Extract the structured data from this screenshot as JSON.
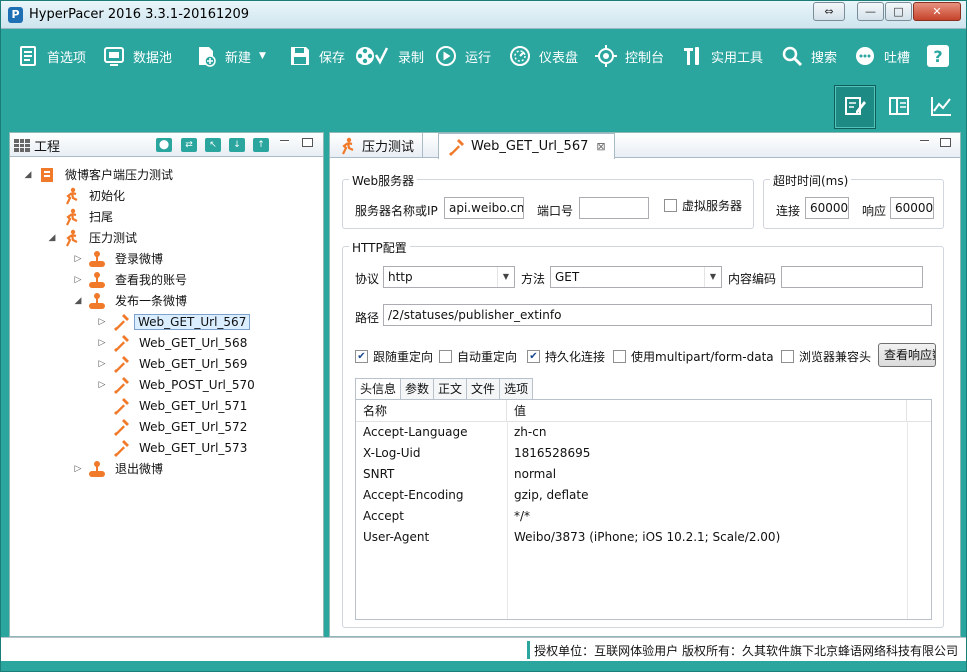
{
  "window": {
    "title": "HyperPacer  2016 3.3.1-20161209",
    "app_icon_letter": "P",
    "restore_symbol": "⇔",
    "minimize_symbol": "—",
    "maximize_symbol": "□",
    "close_symbol": "✕"
  },
  "colors": {
    "accent": "#2aa69f",
    "icon_orange": "#f07a2a",
    "selection": "#dbeeff"
  },
  "toolbar": {
    "items": [
      {
        "label": "首选项",
        "icon": "preferences-icon"
      },
      {
        "label": "数据池",
        "icon": "datapool-icon"
      },
      {
        "label": "新建",
        "icon": "new-file-icon"
      },
      {
        "label": "保存",
        "icon": "save-icon"
      },
      {
        "label": "录制",
        "icon": "record-icon"
      },
      {
        "label": "运行",
        "icon": "run-icon"
      },
      {
        "label": "仪表盘",
        "icon": "dashboard-icon"
      },
      {
        "label": "控制台",
        "icon": "console-icon"
      },
      {
        "label": "实用工具",
        "icon": "tools-icon"
      },
      {
        "label": "搜索",
        "icon": "search-icon"
      },
      {
        "label": "吐槽",
        "icon": "feedback-icon"
      },
      {
        "label": "",
        "icon": "help-icon"
      }
    ],
    "dropdown_symbol": "▼",
    "help_symbol": "?"
  },
  "viewbar": [
    "edit-view-icon",
    "panel-view-icon",
    "chart-view-icon"
  ],
  "project": {
    "tab_label": "工程",
    "tools": [
      "⬤",
      "⇄",
      "↖",
      "↓",
      "↑"
    ],
    "tree": [
      {
        "label": "微博客户端压力测试",
        "icon": "project-icon",
        "twisty": "◢",
        "depth": 0
      },
      {
        "label": "初始化",
        "icon": "runner-icon",
        "twisty": "",
        "depth": 1
      },
      {
        "label": "扫尾",
        "icon": "runner-icon",
        "twisty": "",
        "depth": 1
      },
      {
        "label": "压力测试",
        "icon": "runner-icon",
        "twisty": "◢",
        "depth": 1
      },
      {
        "label": "登录微博",
        "icon": "transaction-icon",
        "twisty": "▷",
        "depth": 2
      },
      {
        "label": "查看我的账号",
        "icon": "transaction-icon",
        "twisty": "▷",
        "depth": 2
      },
      {
        "label": "发布一条微博",
        "icon": "transaction-icon",
        "twisty": "◢",
        "depth": 2
      },
      {
        "label": "Web_GET_Url_567",
        "icon": "request-icon",
        "twisty": "▷",
        "depth": 3,
        "selected": true
      },
      {
        "label": "Web_GET_Url_568",
        "icon": "request-icon",
        "twisty": "▷",
        "depth": 3
      },
      {
        "label": "Web_GET_Url_569",
        "icon": "request-icon",
        "twisty": "▷",
        "depth": 3
      },
      {
        "label": "Web_POST_Url_570",
        "icon": "request-icon",
        "twisty": "▷",
        "depth": 3
      },
      {
        "label": "Web_GET_Url_571",
        "icon": "request-icon",
        "twisty": "",
        "depth": 3
      },
      {
        "label": "Web_GET_Url_572",
        "icon": "request-icon",
        "twisty": "",
        "depth": 3
      },
      {
        "label": "Web_GET_Url_573",
        "icon": "request-icon",
        "twisty": "",
        "depth": 3
      },
      {
        "label": "退出微博",
        "icon": "transaction-icon",
        "twisty": "▷",
        "depth": 2
      }
    ]
  },
  "editor": {
    "tabs": [
      {
        "label": "压力测试",
        "icon": "runner-icon",
        "active": false
      },
      {
        "label": "Web_GET_Url_567",
        "icon": "request-icon",
        "active": true,
        "close": "⊠"
      }
    ],
    "web_server": {
      "title": "Web服务器",
      "host_label": "服务器名称或IP",
      "host_value": "api.weibo.cn",
      "port_label": "端口号",
      "port_value": "",
      "virtual_label": "虚拟服务器",
      "virtual_checked": false
    },
    "timeout": {
      "title": "超时时间(ms)",
      "connect_label": "连接",
      "connect_value": "60000",
      "response_label": "响应",
      "response_value": "60000"
    },
    "http": {
      "title": "HTTP配置",
      "protocol_label": "协议",
      "protocol_value": "http",
      "method_label": "方法",
      "method_value": "GET",
      "encoding_label": "内容编码",
      "encoding_value": "",
      "path_label": "路径",
      "path_value": "/2/statuses/publisher_extinfo",
      "options": [
        {
          "label": "跟随重定向",
          "checked": true
        },
        {
          "label": "自动重定向",
          "checked": false
        },
        {
          "label": "持久化连接",
          "checked": true
        },
        {
          "label": "使用multipart/form-data",
          "checked": false
        },
        {
          "label": "浏览器兼容头",
          "checked": false
        }
      ],
      "view_response_button": "查看响应数",
      "check_mark": "✔"
    },
    "subtabs": [
      "头信息",
      "参数",
      "正文",
      "文件",
      "选项"
    ],
    "headers_table": {
      "columns": [
        "名称",
        "值"
      ],
      "rows": [
        [
          "Accept-Language",
          "zh-cn"
        ],
        [
          "X-Log-Uid",
          "1816528695"
        ],
        [
          "SNRT",
          "normal"
        ],
        [
          "Accept-Encoding",
          "gzip, deflate"
        ],
        [
          "Accept",
          "*/*"
        ],
        [
          "User-Agent",
          "Weibo/3873 (iPhone; iOS 10.2.1; Scale/2.00)"
        ]
      ]
    }
  },
  "status_bar": {
    "text": "授权单位：互联网体验用户 版权所有：久其软件旗下北京蜂语网络科技有限公司"
  }
}
